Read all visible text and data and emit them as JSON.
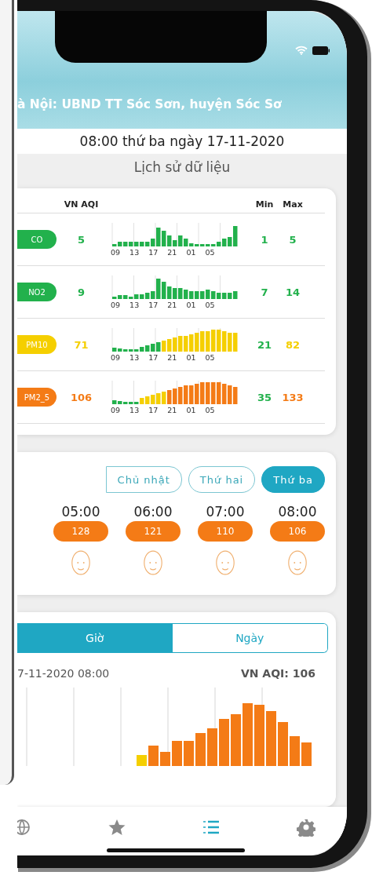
{
  "header": {
    "title": "à Nội: UBND TT Sóc Sơn, huyện Sóc Sơ"
  },
  "date_line": "08:00 thứ ba ngày 17-11-2020",
  "section_title": "Lịch sử dữ liệu",
  "pollutant_table": {
    "columns": [
      "VN AQI",
      "Min",
      "Max"
    ],
    "rows": [
      {
        "name": "CO",
        "color": "#22b14c",
        "aqi": "5",
        "min": "1",
        "max": "5",
        "ticks": [
          "09",
          "13",
          "17",
          "21",
          "01",
          "05"
        ]
      },
      {
        "name": "NO2",
        "color": "#22b14c",
        "aqi": "9",
        "min": "7",
        "max": "14",
        "ticks": [
          "09",
          "13",
          "17",
          "21",
          "01",
          "05"
        ]
      },
      {
        "name": "PM10",
        "color": "#f5cf00",
        "aqi": "71",
        "min": "21",
        "max": "82",
        "ticks": [
          "09",
          "13",
          "17",
          "21",
          "01",
          "05"
        ]
      },
      {
        "name": "PM2_5",
        "color": "#f47b16",
        "aqi": "106",
        "min": "35",
        "max": "133",
        "ticks": [
          "09",
          "13",
          "17",
          "21",
          "01",
          "05"
        ]
      }
    ]
  },
  "day_tabs": [
    {
      "label": "Chủ nhật",
      "selected": false
    },
    {
      "label": "Thứ hai",
      "selected": false
    },
    {
      "label": "Thứ ba",
      "selected": true
    }
  ],
  "hours": [
    {
      "time": "05:00",
      "value": "128",
      "color": "#f47b16"
    },
    {
      "time": "06:00",
      "value": "121",
      "color": "#f47b16"
    },
    {
      "time": "07:00",
      "value": "110",
      "color": "#f47b16"
    },
    {
      "time": "08:00",
      "value": "106",
      "color": "#f47b16"
    }
  ],
  "range_tabs": [
    {
      "label": "Giờ",
      "selected": true
    },
    {
      "label": "Ngày",
      "selected": false
    }
  ],
  "detail": {
    "timestamp": "7-11-2020 08:00",
    "aqi": "VN AQI: 106"
  },
  "tab_bar": [
    {
      "kind": "globe",
      "selected": false
    },
    {
      "kind": "star",
      "selected": false
    },
    {
      "kind": "list",
      "selected": true
    },
    {
      "kind": "gear",
      "selected": false
    }
  ]
}
